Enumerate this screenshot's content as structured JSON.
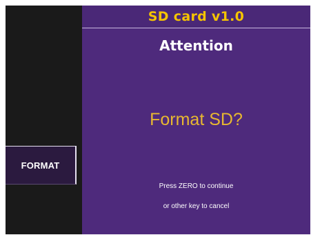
{
  "window": {
    "title": "SD card v1.0"
  },
  "sidebar": {
    "softkey_label": "FORMAT"
  },
  "dialog": {
    "heading": "Attention",
    "question": "Format SD?",
    "hint_line1": "Press ZERO to continue",
    "hint_line2": "or other key to cancel"
  },
  "colors": {
    "background": "#1a1a1a",
    "panel": "#4e2a7c",
    "title_text": "#f5c400",
    "question_text": "#e8b830",
    "text": "#ffffff"
  }
}
